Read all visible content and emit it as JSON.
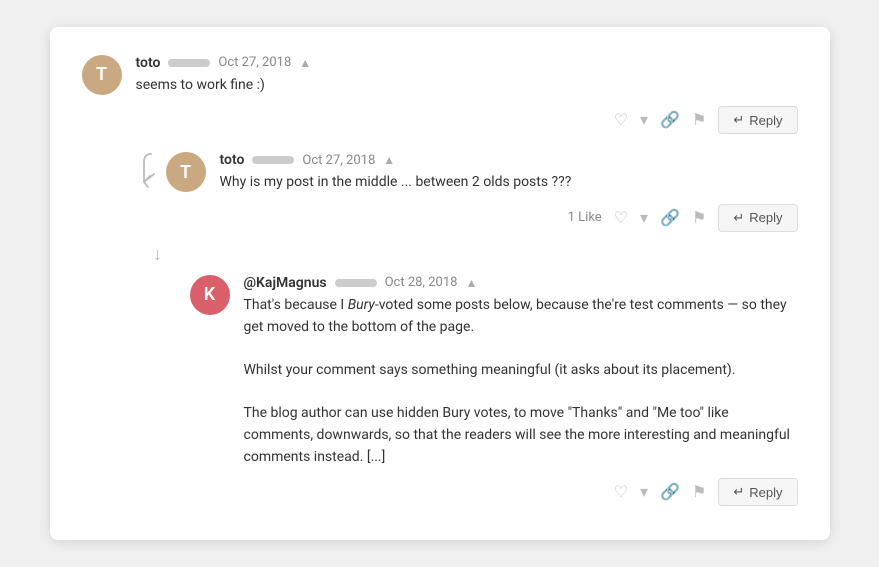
{
  "comments": [
    {
      "id": "comment-1",
      "avatar_letter": "T",
      "avatar_class": "avatar-tan",
      "author": "toto",
      "date": "Oct 27, 2018",
      "text": "seems to work fine :)",
      "like_count": null,
      "reply_label": "Reply",
      "level": 0
    },
    {
      "id": "comment-2",
      "avatar_letter": "T",
      "avatar_class": "avatar-tan",
      "author": "toto",
      "date": "Oct 27, 2018",
      "text": "Why is my post in the middle ... between 2 olds posts ???",
      "like_count": "1 Like",
      "reply_label": "Reply",
      "level": 1
    },
    {
      "id": "comment-3",
      "avatar_letter": "K",
      "avatar_class": "avatar-pink",
      "author": "@KajMagnus",
      "date": "Oct 28, 2018",
      "text_parts": [
        "That’s because I ",
        "Bury",
        "-voted some posts below, because the’re test comments — so they get moved to the bottom of the page.",
        "\n\nWhilst your comment says something meaningful (it asks about its placement).",
        "\n\nThe blog author can use hidden Bury votes, to move “Thanks” and “Me too” like comments, downwards, so that the readers will see the more interesting and meaningful comments instead. [...]"
      ],
      "like_count": null,
      "reply_label": "Reply",
      "level": 2
    }
  ],
  "icons": {
    "heart": "♥",
    "down_vote": "▼",
    "link": "🔗",
    "flag": "⚑",
    "reply_arrow": "↵"
  }
}
